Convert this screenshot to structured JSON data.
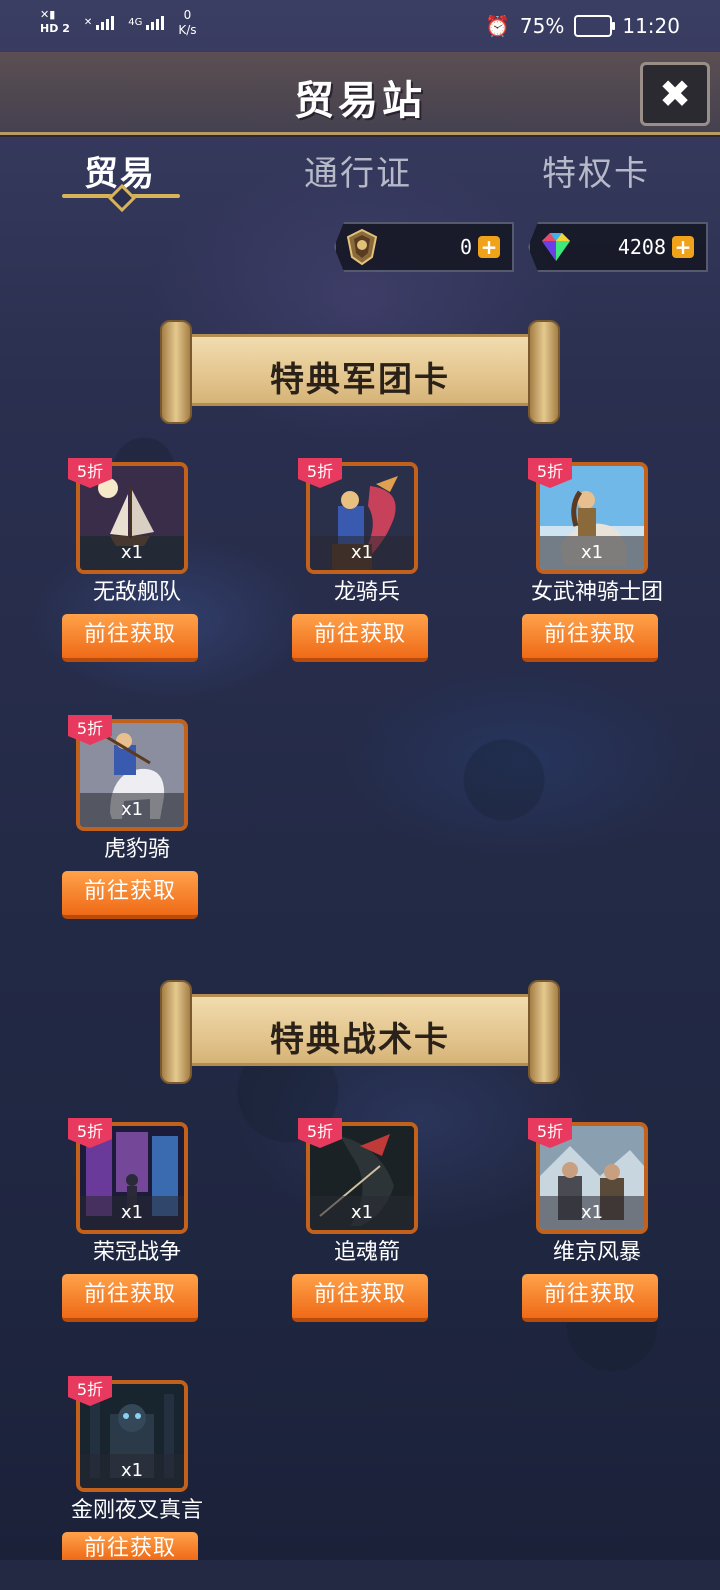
{
  "status_bar": {
    "net_top": "0",
    "net_unit": "K/s",
    "signal_labels": [
      "HD",
      "2",
      "4G"
    ],
    "battery": "75%",
    "time": "11:20"
  },
  "header": {
    "title": "贸易站",
    "close_icon": "close-icon"
  },
  "tabs": [
    {
      "label": "贸易",
      "active": true
    },
    {
      "label": "通行证",
      "active": false
    },
    {
      "label": "特权卡",
      "active": false
    }
  ],
  "currency": [
    {
      "icon": "crest-icon",
      "value": "0"
    },
    {
      "icon": "gem-icon",
      "value": "4208"
    }
  ],
  "sections": [
    {
      "title": "特典军团卡",
      "items": [
        {
          "name": "无敌舰队",
          "badge": "5折",
          "qty": "x1",
          "button": "前往获取"
        },
        {
          "name": "龙骑兵",
          "badge": "5折",
          "qty": "x1",
          "button": "前往获取"
        },
        {
          "name": "女武神骑士团",
          "badge": "5折",
          "qty": "x1",
          "button": "前往获取"
        },
        {
          "name": "虎豹骑",
          "badge": "5折",
          "qty": "x1",
          "button": "前往获取"
        }
      ]
    },
    {
      "title": "特典战术卡",
      "items": [
        {
          "name": "荣冠战争",
          "badge": "5折",
          "qty": "x1",
          "button": "前往获取"
        },
        {
          "name": "追魂箭",
          "badge": "5折",
          "qty": "x1",
          "button": "前往获取"
        },
        {
          "name": "维京风暴",
          "badge": "5折",
          "qty": "x1",
          "button": "前往获取"
        },
        {
          "name": "金刚夜叉真言",
          "badge": "5折",
          "qty": "x1",
          "button": "前往获取"
        }
      ]
    }
  ],
  "colors": {
    "accent_gold": "#d9b35a",
    "button_orange": "#ef6a17",
    "badge_pink": "#e83a5e",
    "card_border": "#c2611b"
  }
}
